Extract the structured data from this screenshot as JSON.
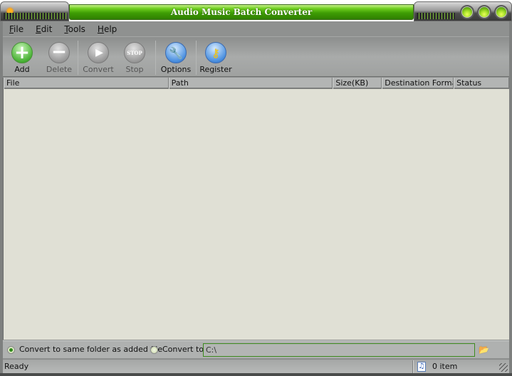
{
  "window": {
    "title": "Audio Music Batch Converter",
    "app_icon": "sun-icon",
    "controls": [
      {
        "name": "minimize",
        "icon": "green-orb"
      },
      {
        "name": "maximize",
        "icon": "green-orb"
      },
      {
        "name": "close",
        "icon": "green-orb"
      }
    ]
  },
  "menu": {
    "items": [
      {
        "label": "File",
        "accel": "F",
        "rest": "ile"
      },
      {
        "label": "Edit",
        "accel": "E",
        "rest": "dit"
      },
      {
        "label": "Tools",
        "accel": "T",
        "rest": "ools"
      },
      {
        "label": "Help",
        "accel": "H",
        "rest": "elp"
      }
    ]
  },
  "toolbar": {
    "buttons": [
      {
        "label": "Add",
        "icon": "plus-icon",
        "enabled": true
      },
      {
        "label": "Delete",
        "icon": "minus-icon",
        "enabled": false
      },
      {
        "label": "Convert",
        "icon": "play-icon",
        "enabled": false
      },
      {
        "label": "Stop",
        "icon": "stop-icon",
        "glyph": "STOP",
        "enabled": false
      },
      {
        "label": "Options",
        "icon": "wrench-icon",
        "enabled": true
      },
      {
        "label": "Register",
        "icon": "key-icon",
        "enabled": true
      }
    ]
  },
  "list": {
    "columns": [
      "File",
      "Path",
      "Size(KB)",
      "Destination Format",
      "Status"
    ],
    "rows": []
  },
  "output": {
    "option_same_folder": "Convert to same folder as added file",
    "option_convert_to": "Convert to",
    "selected": "same_folder",
    "path_value": "C:\\",
    "browse_icon": "folder-browse-icon"
  },
  "status": {
    "text": "Ready",
    "count": "0 item",
    "count_icon": "music-file-icon"
  },
  "colors": {
    "title_green": "#4fae0f",
    "chrome_gray": "#8f9190",
    "list_bg": "#e0e0d5",
    "input_border": "#3c8a1e"
  }
}
